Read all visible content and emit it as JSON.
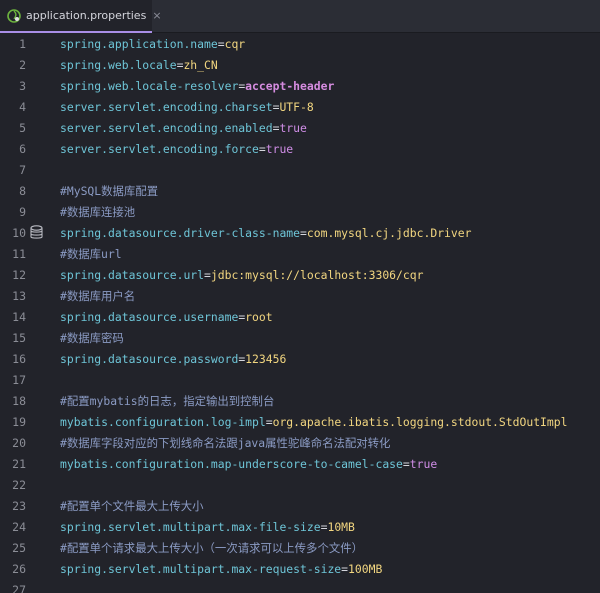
{
  "tab": {
    "label": "application.properties",
    "close": "×",
    "icon": "spring-leaf-icon"
  },
  "gutter": {
    "db_icon_line": 10,
    "db_icon": "database-icon"
  },
  "colors": {
    "key": "#6ec5d7",
    "value": "#f2d680",
    "boolean": "#cf8de6",
    "comment": "#8b9bc4",
    "accent": "#a98ee6",
    "background": "#22232a"
  },
  "lines": [
    {
      "n": "1",
      "kind": "prop",
      "key": "spring.application.name",
      "value": "cqr",
      "vt": "v"
    },
    {
      "n": "2",
      "kind": "prop",
      "key": "spring.web.locale",
      "value": "zh_CN",
      "vt": "v"
    },
    {
      "n": "3",
      "kind": "prop",
      "key": "spring.web.locale-resolver",
      "value": "accept-header",
      "vt": "acc"
    },
    {
      "n": "4",
      "kind": "prop",
      "key": "server.servlet.encoding.charset",
      "value": "UTF-8",
      "vt": "v"
    },
    {
      "n": "5",
      "kind": "prop",
      "key": "server.servlet.encoding.enabled",
      "value": "true",
      "vt": "kw"
    },
    {
      "n": "6",
      "kind": "prop",
      "key": "server.servlet.encoding.force",
      "value": "true",
      "vt": "kw"
    },
    {
      "n": "7",
      "kind": "blank"
    },
    {
      "n": "8",
      "kind": "comment",
      "text": "#MySQL数据库配置"
    },
    {
      "n": "9",
      "kind": "comment",
      "text": "#数据库连接池"
    },
    {
      "n": "10",
      "kind": "prop",
      "key": "spring.datasource.driver-class-name",
      "value": "com.mysql.cj.jdbc.Driver",
      "vt": "v"
    },
    {
      "n": "11",
      "kind": "comment",
      "text": "#数据库url"
    },
    {
      "n": "12",
      "kind": "prop",
      "key": "spring.datasource.url",
      "value": "jdbc:mysql://localhost:3306/cqr",
      "vt": "v"
    },
    {
      "n": "13",
      "kind": "comment",
      "text": "#数据库用户名"
    },
    {
      "n": "14",
      "kind": "prop",
      "key": "spring.datasource.username",
      "value": "root",
      "vt": "v"
    },
    {
      "n": "15",
      "kind": "comment",
      "text": "#数据库密码"
    },
    {
      "n": "16",
      "kind": "prop",
      "key": "spring.datasource.password",
      "value": "123456",
      "vt": "v"
    },
    {
      "n": "17",
      "kind": "blank"
    },
    {
      "n": "18",
      "kind": "comment",
      "text": "#配置mybatis的日志，指定输出到控制台"
    },
    {
      "n": "19",
      "kind": "prop",
      "key": "mybatis.configuration.log-impl",
      "value": "org.apache.ibatis.logging.stdout.StdOutImpl",
      "vt": "v"
    },
    {
      "n": "20",
      "kind": "comment",
      "text": "#数据库字段对应的下划线命名法跟java属性驼峰命名法配对转化"
    },
    {
      "n": "21",
      "kind": "prop",
      "key": "mybatis.configuration.map-underscore-to-camel-case",
      "value": "true",
      "vt": "kw"
    },
    {
      "n": "22",
      "kind": "blank"
    },
    {
      "n": "23",
      "kind": "comment",
      "text": "#配置单个文件最大上传大小"
    },
    {
      "n": "24",
      "kind": "prop",
      "key": "spring.servlet.multipart.max-file-size",
      "value": "10MB",
      "vt": "v"
    },
    {
      "n": "25",
      "kind": "comment",
      "text": "#配置单个请求最大上传大小（一次请求可以上传多个文件）"
    },
    {
      "n": "26",
      "kind": "prop",
      "key": "spring.servlet.multipart.max-request-size",
      "value": "100MB",
      "vt": "v"
    },
    {
      "n": "27",
      "kind": "blank"
    }
  ]
}
